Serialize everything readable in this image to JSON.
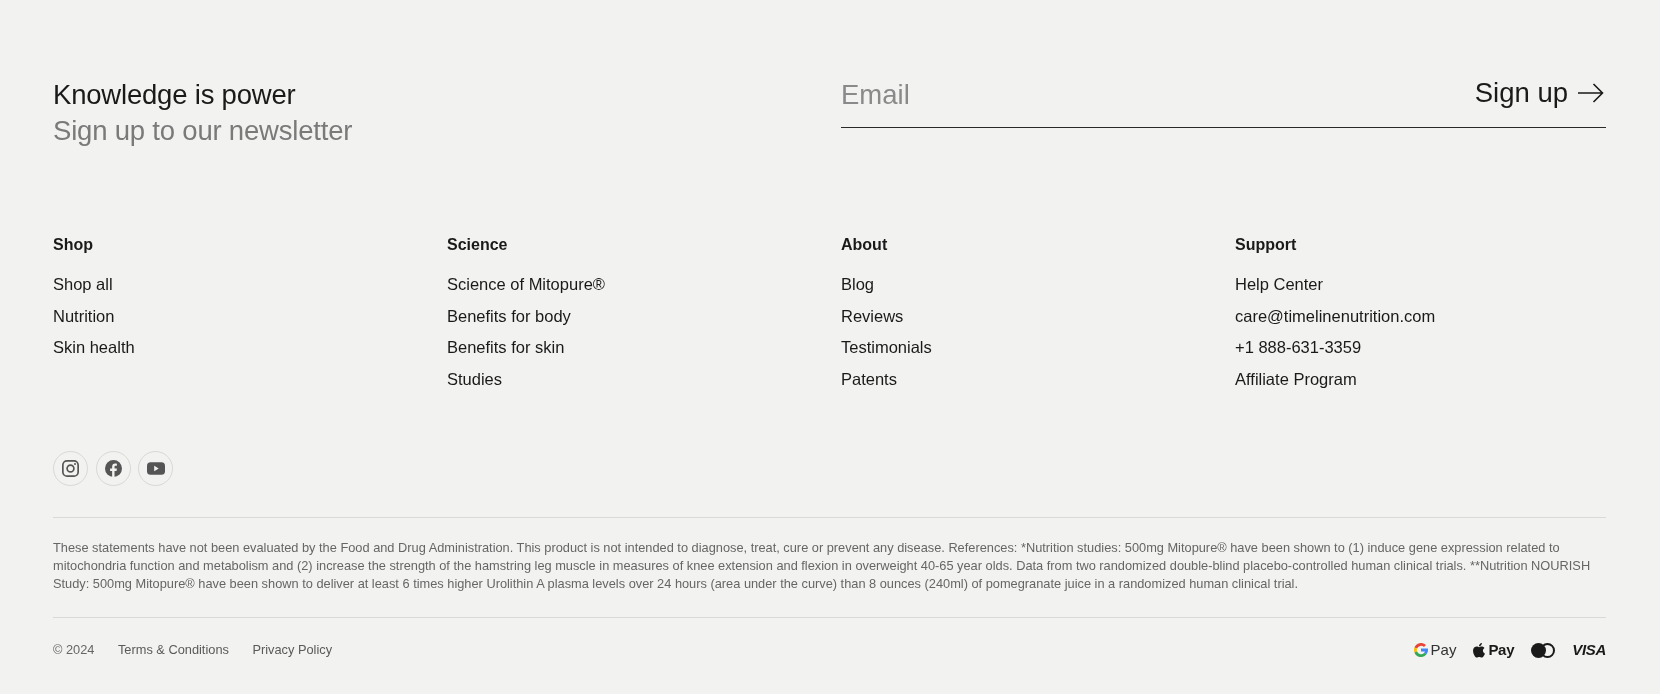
{
  "newsletter": {
    "title": "Knowledge is power",
    "subtitle": "Sign up to our newsletter",
    "email": {
      "placeholder": "Email"
    },
    "submit": "Sign up"
  },
  "link_columns": [
    {
      "heading": "Shop",
      "links": [
        "Shop all",
        "Nutrition",
        "Skin health"
      ]
    },
    {
      "heading": "Science",
      "links": [
        "Science of Mitopure®",
        "Benefits for body",
        "Benefits for skin",
        "Studies"
      ]
    },
    {
      "heading": "About",
      "links": [
        "Blog",
        "Reviews",
        "Testimonials",
        "Patents"
      ]
    },
    {
      "heading": "Support",
      "links": [
        "Help Center",
        "care@timelinenutrition.com",
        "+1 888-631-3359",
        "Affiliate Program"
      ]
    }
  ],
  "disclaimer": "These statements have not been evaluated by the Food and Drug Administration. This product is not intended to diagnose, treat, cure or prevent any disease. References: *Nutrition studies: 500mg Mitopure® have been shown to (1) induce gene expression related to mitochondria function and metabolism and (2) increase the strength of the hamstring leg muscle in measures of knee extension and flexion in overweight 40-65 year olds. Data from two randomized double-blind placebo-controlled human clinical trials. **Nutrition NOURISH Study: 500mg Mitopure® have been shown to deliver at least 6 times higher Urolithin A plasma levels over 24 hours (area under the curve) than 8 ounces (240ml) of pomegranate juice in a randomized human clinical trial.",
  "bottom_bar": {
    "copyright": "© 2024",
    "links": [
      "Terms & Conditions",
      "Privacy Policy"
    ],
    "payment_methods": [
      {
        "kind": "google_pay",
        "label": "Pay"
      },
      {
        "kind": "apple_pay",
        "label": "Pay"
      },
      {
        "kind": "mastercard"
      },
      {
        "kind": "visa",
        "label": "VISA"
      }
    ]
  }
}
